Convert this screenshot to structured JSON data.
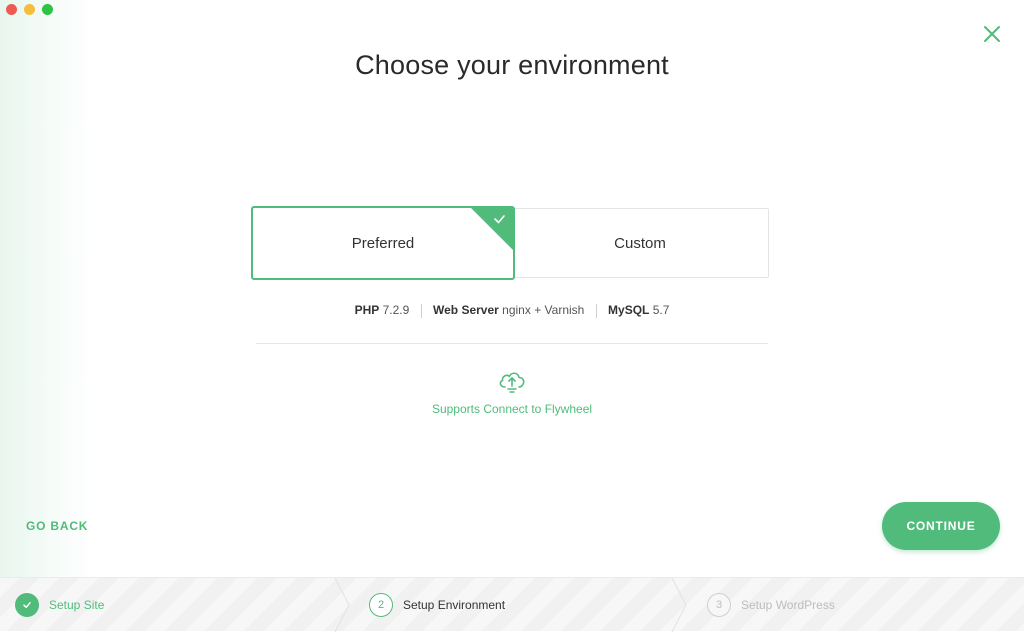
{
  "window": {
    "traffic_lights": [
      "close",
      "minimize",
      "zoom"
    ]
  },
  "header": {
    "title": "Choose your environment",
    "close_icon": "close-icon"
  },
  "environment_options": {
    "selected": "Preferred",
    "preferred_label": "Preferred",
    "custom_label": "Custom"
  },
  "specs": {
    "php_label": "PHP",
    "php_version": "7.2.9",
    "web_server_label": "Web Server",
    "web_server_value": "nginx + Varnish",
    "mysql_label": "MySQL",
    "mysql_version": "5.7"
  },
  "flywheel": {
    "icon": "cloud-upload-icon",
    "text": "Supports Connect to Flywheel"
  },
  "actions": {
    "back_label": "GO BACK",
    "continue_label": "CONTINUE"
  },
  "steps": [
    {
      "number": "1",
      "label": "Setup Site",
      "state": "complete"
    },
    {
      "number": "2",
      "label": "Setup Environment",
      "state": "active"
    },
    {
      "number": "3",
      "label": "Setup WordPress",
      "state": "pending"
    }
  ],
  "colors": {
    "accent": "#51bb7b",
    "muted": "#bdbdbd"
  }
}
